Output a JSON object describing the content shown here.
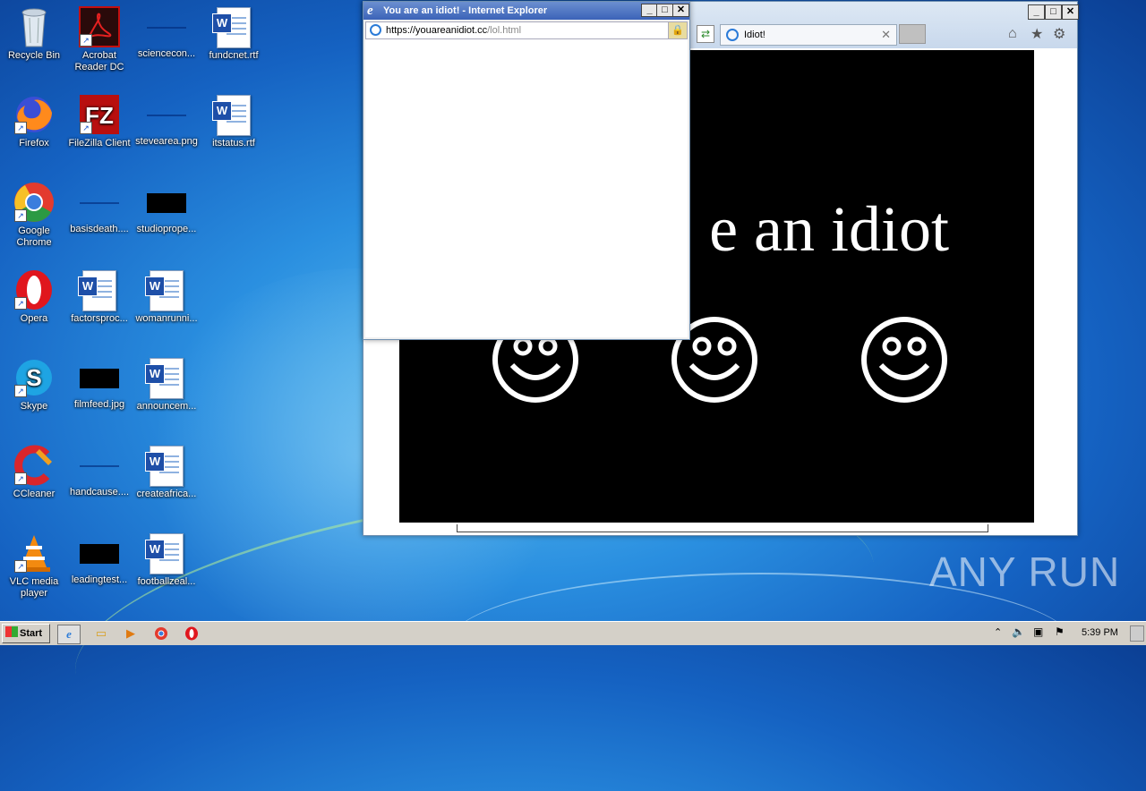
{
  "desktop": {
    "icons": [
      {
        "label": "Recycle Bin"
      },
      {
        "label": "Acrobat Reader DC"
      },
      {
        "label": "sciencecon..."
      },
      {
        "label": "fundcnet.rtf"
      },
      {
        "label": "Firefox"
      },
      {
        "label": "FileZilla Client"
      },
      {
        "label": "stevearea.png"
      },
      {
        "label": "itstatus.rtf"
      },
      {
        "label": "Google Chrome"
      },
      {
        "label": "basisdeath...."
      },
      {
        "label": "studioprope..."
      },
      {
        "label": "Opera"
      },
      {
        "label": "factorsproc..."
      },
      {
        "label": "womanrunni..."
      },
      {
        "label": "Skype"
      },
      {
        "label": "filmfeed.jpg"
      },
      {
        "label": "announcem..."
      },
      {
        "label": "CCleaner"
      },
      {
        "label": "handcause...."
      },
      {
        "label": "createafrica..."
      },
      {
        "label": "VLC media player"
      },
      {
        "label": "leadingtest..."
      },
      {
        "label": "footballzeal..."
      }
    ],
    "watermark": "ANY RUN"
  },
  "ie_main": {
    "tab_label": "Idiot!",
    "page_text": "e an idiot",
    "smiley_count": 3
  },
  "popup": {
    "title": "You are an idiot! - Internet Explorer",
    "url_host": "https://youareanidiot.cc",
    "url_path": "/lol.html"
  },
  "taskbar": {
    "start_label": "Start",
    "clock": "5:39 PM"
  }
}
